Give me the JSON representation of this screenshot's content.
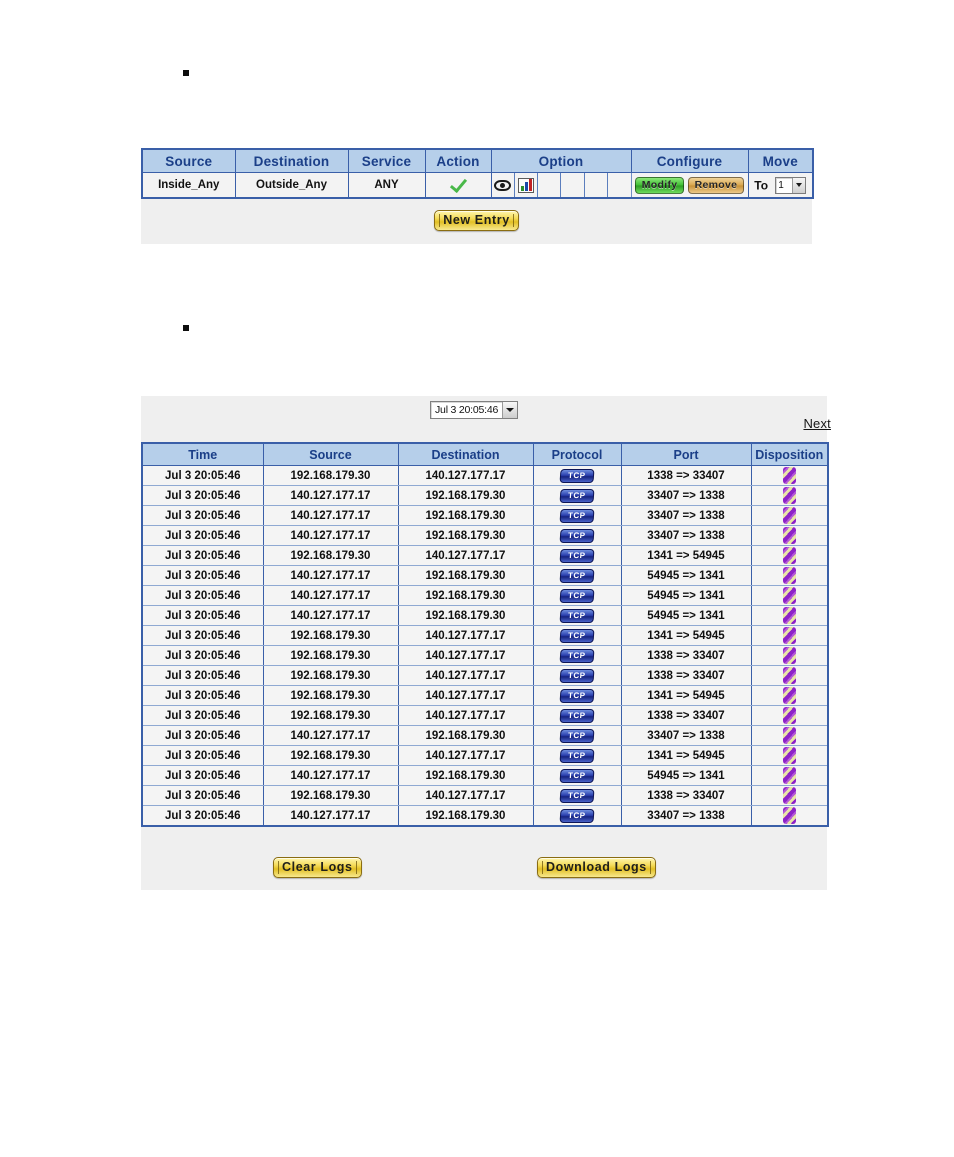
{
  "page": {
    "bullets": [
      "",
      ""
    ]
  },
  "rule_panel": {
    "columns": [
      "Source",
      "Destination",
      "Service",
      "Action",
      "Option",
      "Configure",
      "Move"
    ],
    "row": {
      "source": "Inside_Any",
      "destination": "Outside_Any",
      "service": "ANY",
      "action_icon": "green-check-icon",
      "option_icons": [
        "eye-icon",
        "chart-icon",
        "",
        "",
        "",
        ""
      ],
      "modify_label": "Modify",
      "remove_label": "Remove",
      "move_label": "To",
      "move_value": "1"
    },
    "new_entry_label": "New Entry",
    "colors": {
      "header_bg": "#b6cfea",
      "header_text": "#1b3f88",
      "border": "#3a5fa8",
      "panel_bg": "#efefef",
      "modify_green": "#3fbf33",
      "remove_tan": "#d9a64e",
      "gold": "#f5dc5a"
    }
  },
  "log_panel": {
    "date_select_value": "Jul 3 20:05:46",
    "next_link_label": "Next",
    "columns": [
      "Time",
      "Source",
      "Destination",
      "Protocol",
      "Port",
      "Disposition"
    ],
    "rows": [
      {
        "time": "Jul 3 20:05:46",
        "source": "192.168.179.30",
        "destination": "140.127.177.17",
        "protocol": "TCP",
        "port": "1338 => 33407",
        "disposition": "pass-icon"
      },
      {
        "time": "Jul 3 20:05:46",
        "source": "140.127.177.17",
        "destination": "192.168.179.30",
        "protocol": "TCP",
        "port": "33407 => 1338",
        "disposition": "pass-icon"
      },
      {
        "time": "Jul 3 20:05:46",
        "source": "140.127.177.17",
        "destination": "192.168.179.30",
        "protocol": "TCP",
        "port": "33407 => 1338",
        "disposition": "pass-icon"
      },
      {
        "time": "Jul 3 20:05:46",
        "source": "140.127.177.17",
        "destination": "192.168.179.30",
        "protocol": "TCP",
        "port": "33407 => 1338",
        "disposition": "pass-icon"
      },
      {
        "time": "Jul 3 20:05:46",
        "source": "192.168.179.30",
        "destination": "140.127.177.17",
        "protocol": "TCP",
        "port": "1341 => 54945",
        "disposition": "pass-icon"
      },
      {
        "time": "Jul 3 20:05:46",
        "source": "140.127.177.17",
        "destination": "192.168.179.30",
        "protocol": "TCP",
        "port": "54945 => 1341",
        "disposition": "pass-icon"
      },
      {
        "time": "Jul 3 20:05:46",
        "source": "140.127.177.17",
        "destination": "192.168.179.30",
        "protocol": "TCP",
        "port": "54945 => 1341",
        "disposition": "pass-icon"
      },
      {
        "time": "Jul 3 20:05:46",
        "source": "140.127.177.17",
        "destination": "192.168.179.30",
        "protocol": "TCP",
        "port": "54945 => 1341",
        "disposition": "pass-icon"
      },
      {
        "time": "Jul 3 20:05:46",
        "source": "192.168.179.30",
        "destination": "140.127.177.17",
        "protocol": "TCP",
        "port": "1341 => 54945",
        "disposition": "pass-icon"
      },
      {
        "time": "Jul 3 20:05:46",
        "source": "192.168.179.30",
        "destination": "140.127.177.17",
        "protocol": "TCP",
        "port": "1338 => 33407",
        "disposition": "pass-icon"
      },
      {
        "time": "Jul 3 20:05:46",
        "source": "192.168.179.30",
        "destination": "140.127.177.17",
        "protocol": "TCP",
        "port": "1338 => 33407",
        "disposition": "pass-icon"
      },
      {
        "time": "Jul 3 20:05:46",
        "source": "192.168.179.30",
        "destination": "140.127.177.17",
        "protocol": "TCP",
        "port": "1341 => 54945",
        "disposition": "pass-icon"
      },
      {
        "time": "Jul 3 20:05:46",
        "source": "192.168.179.30",
        "destination": "140.127.177.17",
        "protocol": "TCP",
        "port": "1338 => 33407",
        "disposition": "pass-icon"
      },
      {
        "time": "Jul 3 20:05:46",
        "source": "140.127.177.17",
        "destination": "192.168.179.30",
        "protocol": "TCP",
        "port": "33407 => 1338",
        "disposition": "pass-icon"
      },
      {
        "time": "Jul 3 20:05:46",
        "source": "192.168.179.30",
        "destination": "140.127.177.17",
        "protocol": "TCP",
        "port": "1341 => 54945",
        "disposition": "pass-icon"
      },
      {
        "time": "Jul 3 20:05:46",
        "source": "140.127.177.17",
        "destination": "192.168.179.30",
        "protocol": "TCP",
        "port": "54945 => 1341",
        "disposition": "pass-icon"
      },
      {
        "time": "Jul 3 20:05:46",
        "source": "192.168.179.30",
        "destination": "140.127.177.17",
        "protocol": "TCP",
        "port": "1338 => 33407",
        "disposition": "pass-icon"
      },
      {
        "time": "Jul 3 20:05:46",
        "source": "140.127.177.17",
        "destination": "192.168.179.30",
        "protocol": "TCP",
        "port": "33407 => 1338",
        "disposition": "pass-icon"
      }
    ],
    "clear_logs_label": "Clear Logs",
    "download_logs_label": "Download Logs"
  }
}
